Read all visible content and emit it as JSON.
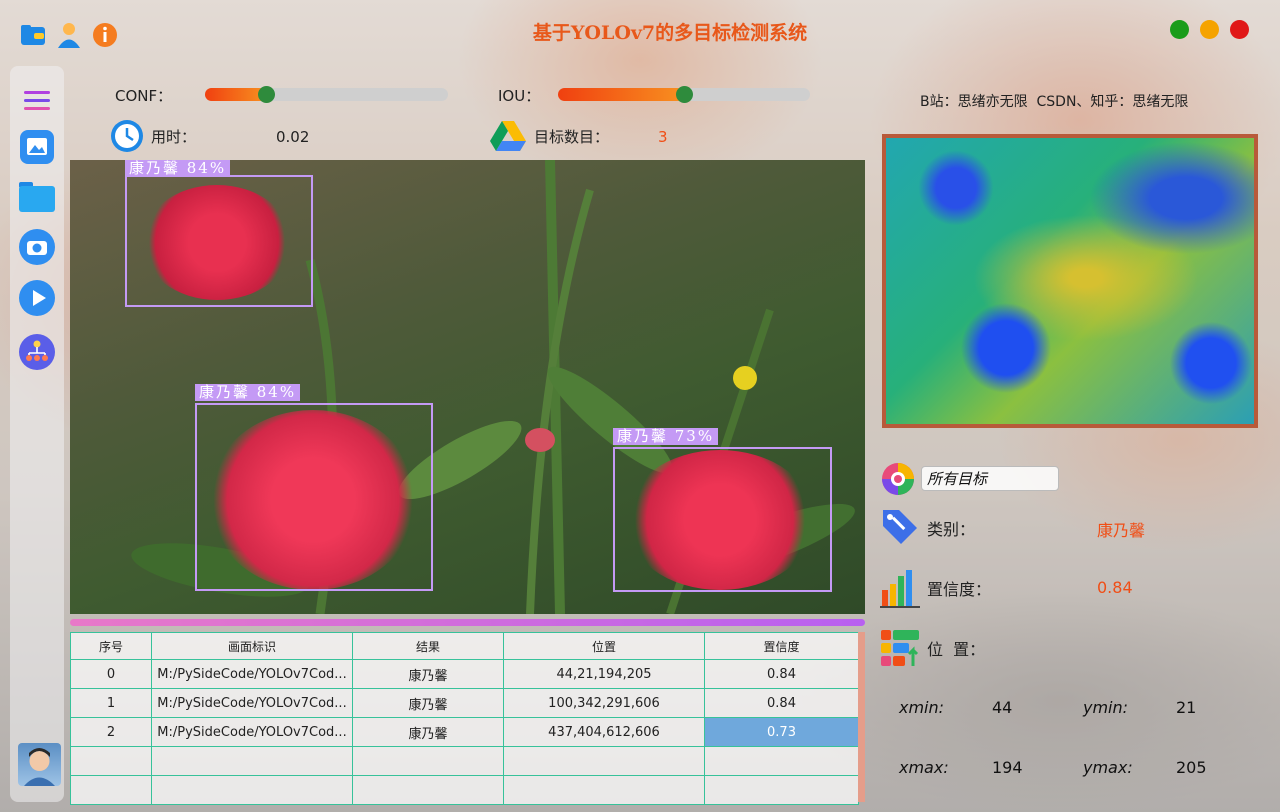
{
  "app": {
    "title": "基于YOLOv7的多目标检测系统"
  },
  "window_controls": {
    "green": "#1a9c1a",
    "orange": "#f5a300",
    "red": "#e01818"
  },
  "controls": {
    "conf_label": "CONF：",
    "conf_value": 0.25,
    "iou_label": "IOU：",
    "iou_value": 0.5
  },
  "stats": {
    "time_label": "用时：",
    "time_value": "0.02",
    "count_label": "目标数目：",
    "count_value": "3"
  },
  "credits": "B站：思绪亦无限  CSDN、知乎：思绪无限",
  "detections": [
    {
      "label": "康乃馨  84%"
    },
    {
      "label": "康乃馨  84%"
    },
    {
      "label": "康乃馨  73%"
    }
  ],
  "table": {
    "headers": [
      "序号",
      "画面标识",
      "结果",
      "位置",
      "置信度"
    ],
    "rows": [
      {
        "idx": "0",
        "path": "M:/PySideCode/YOLOv7Cod...",
        "result": "康乃馨",
        "pos": "44,21,194,205",
        "conf": "0.84"
      },
      {
        "idx": "1",
        "path": "M:/PySideCode/YOLOv7Cod...",
        "result": "康乃馨",
        "pos": "100,342,291,606",
        "conf": "0.84"
      },
      {
        "idx": "2",
        "path": "M:/PySideCode/YOLOv7Cod...",
        "result": "康乃馨",
        "pos": "437,404,612,606",
        "conf": "0.73"
      }
    ],
    "selected_row": 2
  },
  "panel": {
    "filter": "所有目标",
    "class_label": "类别：",
    "class_value": "康乃馨",
    "conf_label": "置信度：",
    "conf_value": "0.84",
    "pos_label": "位  置：",
    "xmin_label": "xmin:",
    "xmin_value": "44",
    "ymin_label": "ymin:",
    "ymin_value": "21",
    "xmax_label": "xmax:",
    "xmax_value": "194",
    "ymax_label": "ymax:",
    "ymax_value": "205"
  },
  "icons": {
    "folder_top": "folder-icon",
    "user_top": "user-icon",
    "info_top": "info-icon",
    "menu": "menu-icon",
    "image": "image-icon",
    "folder": "folder-open-icon",
    "camera": "camera-icon",
    "play": "play-icon",
    "model": "model-tree-icon",
    "timer": "timer-icon",
    "drive": "triangle-drive-icon",
    "filter": "color-wheel-icon",
    "class": "tag-icon",
    "conf": "bar-chart-icon",
    "pos": "position-grid-icon"
  }
}
